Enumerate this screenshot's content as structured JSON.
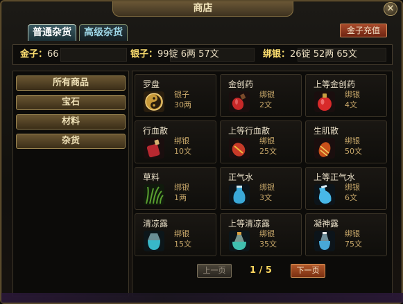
{
  "window": {
    "title": "商店",
    "close_label": "×"
  },
  "tabs": [
    {
      "label": "普通杂货",
      "active": true
    },
    {
      "label": "高级杂货",
      "active": false
    }
  ],
  "recharge_label": "金子充值",
  "currency": {
    "gold_label": "金子：",
    "gold_value": "66",
    "silver_label": "银子：",
    "silver_value": "99锭 6两 57文",
    "bound_label": "绑银：",
    "bound_value": "26锭 52两 65文"
  },
  "categories": [
    {
      "label": "所有商品"
    },
    {
      "label": "宝石"
    },
    {
      "label": "材料"
    },
    {
      "label": "杂货"
    }
  ],
  "items": [
    {
      "name": "罗盘",
      "currency": "银子",
      "price": "30两",
      "icon": "compass-icon",
      "color": "#c89a3a"
    },
    {
      "name": "金创药",
      "currency": "绑银",
      "price": "2文",
      "icon": "red-potion-icon",
      "color": "#c82828"
    },
    {
      "name": "上等金创药",
      "currency": "绑银",
      "price": "4文",
      "icon": "red-potion-icon",
      "color": "#d82a2a"
    },
    {
      "name": "行血散",
      "currency": "绑银",
      "price": "10文",
      "icon": "red-powder-icon",
      "color": "#b82830"
    },
    {
      "name": "上等行血散",
      "currency": "绑银",
      "price": "25文",
      "icon": "red-powder-icon",
      "color": "#c83a28"
    },
    {
      "name": "生肌散",
      "currency": "绑银",
      "price": "50文",
      "icon": "red-powder-icon",
      "color": "#c8501a"
    },
    {
      "name": "草料",
      "currency": "绑银",
      "price": "1两",
      "icon": "grass-icon",
      "color": "#5aa030"
    },
    {
      "name": "正气水",
      "currency": "绑银",
      "price": "3文",
      "icon": "blue-bottle-icon",
      "color": "#3aa8d8"
    },
    {
      "name": "上等正气水",
      "currency": "绑银",
      "price": "6文",
      "icon": "blue-bottle-icon",
      "color": "#48b8e8"
    },
    {
      "name": "清凉露",
      "currency": "绑银",
      "price": "15文",
      "icon": "cyan-flask-icon",
      "color": "#38b8c8"
    },
    {
      "name": "上等清凉露",
      "currency": "绑银",
      "price": "35文",
      "icon": "cyan-flask-icon",
      "color": "#40c0b0"
    },
    {
      "name": "凝神露",
      "currency": "绑银",
      "price": "75文",
      "icon": "cyan-flask-icon",
      "color": "#48a8d8"
    }
  ],
  "pager": {
    "prev_label": "上一页",
    "next_label": "下一页",
    "page_text": "1 / 5"
  }
}
